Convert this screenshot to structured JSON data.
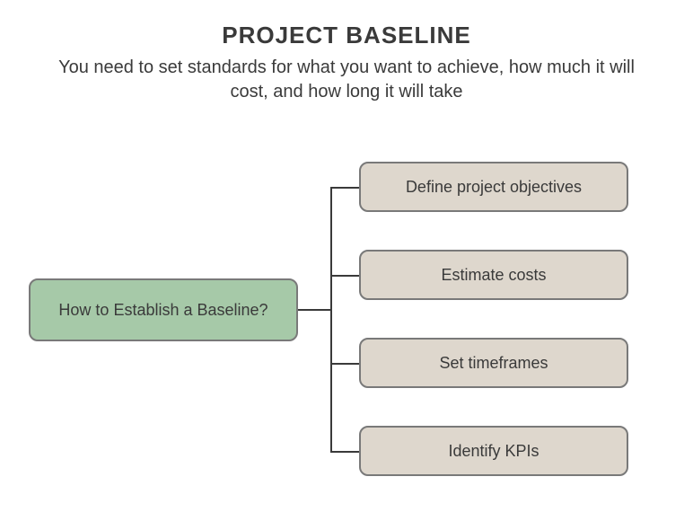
{
  "title": "PROJECT BASELINE",
  "subtitle": "You need to set standards for what you want to achieve, how much it will cost, and how long it will take",
  "root": {
    "label": "How to Establish a Baseline?"
  },
  "leaves": [
    {
      "label": "Define project objectives"
    },
    {
      "label": "Estimate costs"
    },
    {
      "label": "Set timeframes"
    },
    {
      "label": "Identify KPIs"
    }
  ],
  "chart_data": {
    "type": "diagram",
    "root": "How to Establish a Baseline?",
    "children": [
      "Define project objectives",
      "Estimate costs",
      "Set timeframes",
      "Identify KPIs"
    ]
  }
}
